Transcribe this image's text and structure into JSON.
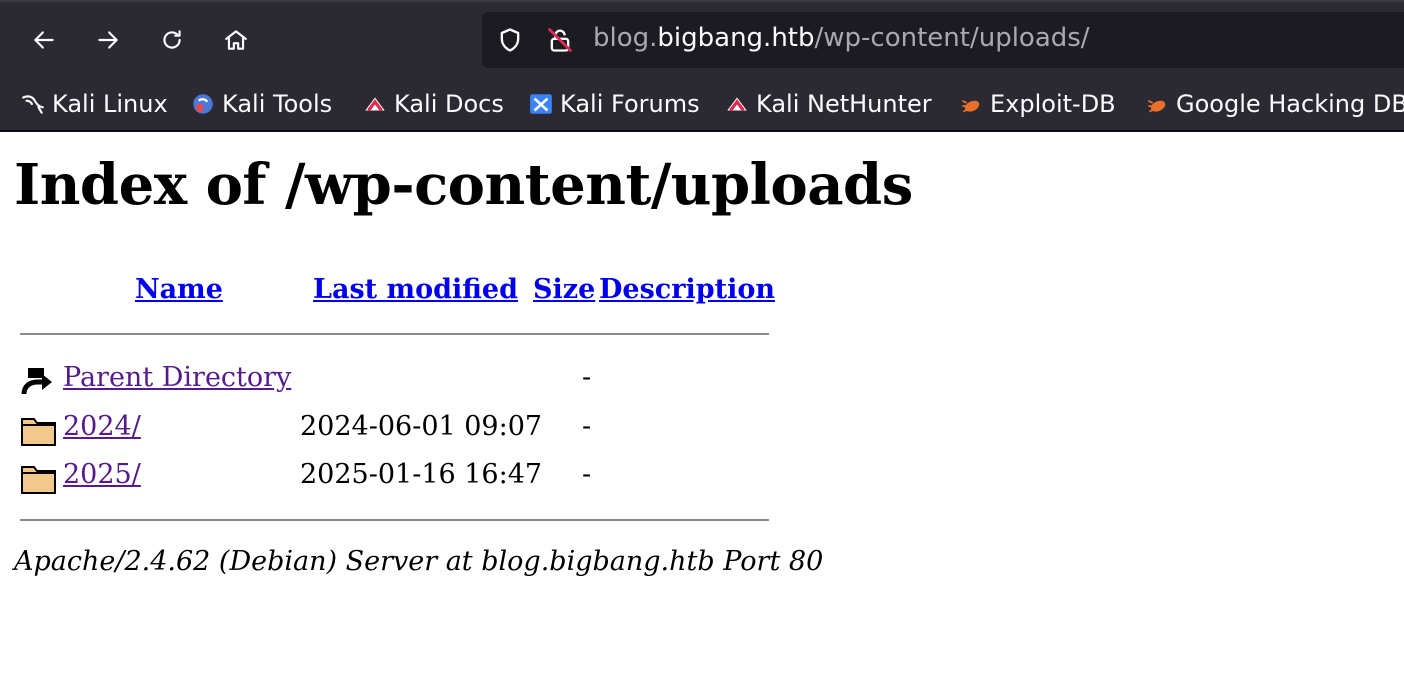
{
  "browser": {
    "url_prefix": "blog.",
    "url_host": "bigbang.htb",
    "url_path": "/wp-content/uploads/",
    "nav_icons": [
      "back-arrow-icon",
      "forward-arrow-icon",
      "reload-icon",
      "home-icon"
    ],
    "bookmarks": [
      {
        "label": "Kali Linux",
        "icon": "kali-dragon-icon"
      },
      {
        "label": "Kali Tools",
        "icon": "kali-tools-icon"
      },
      {
        "label": "Kali Docs",
        "icon": "kali-docs-icon"
      },
      {
        "label": "Kali Forums",
        "icon": "kali-forums-icon"
      },
      {
        "label": "Kali NetHunter",
        "icon": "kali-nethunter-icon"
      },
      {
        "label": "Exploit-DB",
        "icon": "exploit-db-icon"
      },
      {
        "label": "Google Hacking DB",
        "icon": "ghdb-icon"
      }
    ]
  },
  "page": {
    "title": "Index of /wp-content/uploads",
    "columns": {
      "name": "Name",
      "last_modified": "Last modified",
      "size": "Size",
      "description": "Description"
    },
    "rows": [
      {
        "name": "Parent Directory",
        "modified": "",
        "size": "-",
        "icon": "back-folder-icon"
      },
      {
        "name": "2024/",
        "modified": "2024-06-01 09:07",
        "size": "-",
        "icon": "folder-icon"
      },
      {
        "name": "2025/",
        "modified": "2025-01-16 16:47",
        "size": "-",
        "icon": "folder-icon"
      }
    ],
    "footer": "Apache/2.4.62 (Debian) Server at blog.bigbang.htb Port 80"
  },
  "colors": {
    "chrome_bg": "#2b2a33",
    "urlbar_bg": "#1c1b22",
    "link": "#0000ee",
    "visited_link": "#551a8b"
  }
}
